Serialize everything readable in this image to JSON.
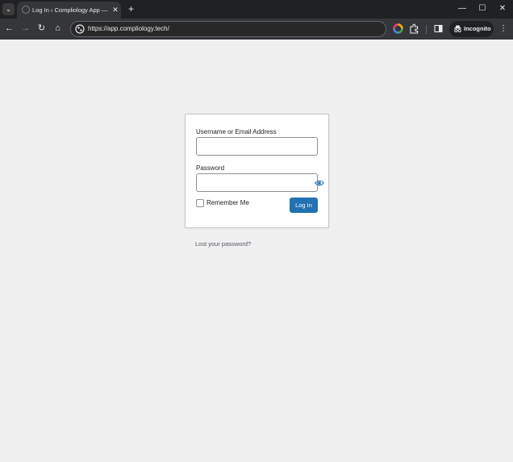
{
  "browser": {
    "tab_title": "Log In ‹ Compliology App — W",
    "tab_close": "✕",
    "new_tab": "+",
    "url": "https://app.compliology.tech/",
    "incognito_label": "Incognito",
    "window_controls": {
      "minimize": "—",
      "maximize": "☐",
      "close": "✕"
    },
    "nav_icons": {
      "back": "←",
      "forward": "→",
      "reload": "↻",
      "home": "⌂",
      "menu": "⋮",
      "tab_search": "⌄"
    }
  },
  "login": {
    "username_label": "Username or Email Address",
    "username_value": "",
    "password_label": "Password",
    "password_value": "",
    "remember_label": "Remember Me",
    "submit_label": "Log In",
    "lost_password": "Lost your password?"
  },
  "colors": {
    "page_bg": "#f0f0f1",
    "primary_button": "#2271b1",
    "chrome_titlebar": "#202124",
    "chrome_toolbar": "#35363a"
  },
  "icons": [
    "tab-search-icon",
    "favicon-icon",
    "close-icon",
    "plus-icon",
    "back-icon",
    "forward-icon",
    "reload-icon",
    "home-icon",
    "site-info-icon",
    "color-wheel-icon",
    "extensions-icon",
    "side-panel-icon",
    "incognito-icon",
    "kebab-menu-icon",
    "eye-icon"
  ]
}
